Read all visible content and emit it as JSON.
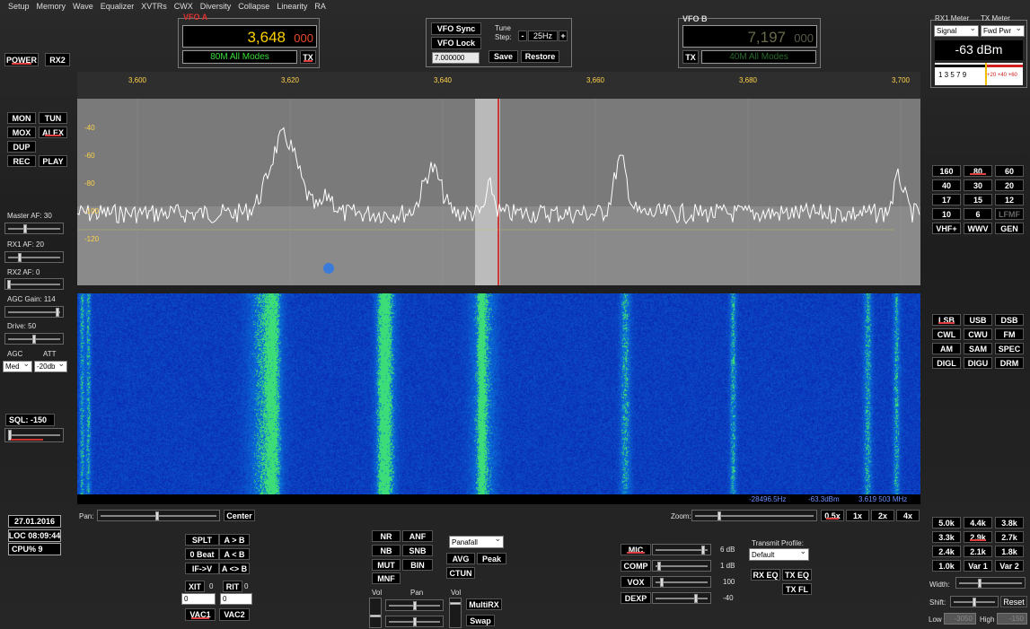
{
  "menu": [
    "Setup",
    "Memory",
    "Wave",
    "Equalizer",
    "XVTRs",
    "CWX",
    "Diversity",
    "Collapse",
    "Linearity",
    "RA"
  ],
  "left": {
    "power": "POWER",
    "rx2": "RX2",
    "mon": "MON",
    "tun": "TUN",
    "mox": "MOX",
    "alex": "ALEX",
    "dup": "DUP",
    "rec": "REC",
    "play": "PLAY",
    "master_af": "Master AF:  30",
    "rx1_af": "RX1 AF:  20",
    "rx2_af": "RX2 AF:  0",
    "agc_gain": "AGC Gain:  114",
    "drive": "Drive:  50",
    "agc": "AGC",
    "att": "ATT",
    "agc_val": "Med",
    "att_val": "-20db",
    "sql": "SQL: -150",
    "date": "27.01.2016",
    "loc": "LOC 08:09:44",
    "cpu": "CPU%  9"
  },
  "vfoa": {
    "label": "VFO A",
    "freq": "3,648",
    "freq_sub": "000",
    "mode": "80M All Modes",
    "tx": "TX"
  },
  "vfob": {
    "label": "VFO B",
    "freq": "7,197",
    "freq_sub": "000",
    "mode": "40M All Modes",
    "tx": "TX"
  },
  "center": {
    "vfo_sync": "VFO Sync",
    "vfo_lock": "VFO Lock",
    "tune": "Tune",
    "step": "Step:",
    "step_val": "25Hz",
    "minus": "-",
    "plus": "+",
    "freq": "7.000000",
    "save": "Save",
    "restore": "Restore"
  },
  "meter": {
    "rx1_label": "RX1 Meter",
    "tx_label": "TX Meter",
    "rx1_val": "Signal",
    "tx_val": "Fwd Pwr",
    "reading": "-63 dBm",
    "scale_white": "1   3   5   7   9",
    "scale_red": "+20 +40 +60"
  },
  "spectrum": {
    "x_ticks": [
      "3,600",
      "3,620",
      "3,640",
      "3,660",
      "3,680",
      "3,700"
    ],
    "y_ticks": [
      "-40",
      "-60",
      "-80",
      "-100",
      "-120"
    ]
  },
  "waterfall": {
    "offset": "-28496.5Hz",
    "dbm": "-63.3dBm",
    "freq": "3.619 503 MHz"
  },
  "bands": [
    [
      "160",
      "80",
      "60"
    ],
    [
      "40",
      "30",
      "20"
    ],
    [
      "17",
      "15",
      "12"
    ],
    [
      "10",
      "6",
      "LFMF"
    ],
    [
      "VHF+",
      "WWV",
      "GEN"
    ]
  ],
  "modes": [
    [
      "LSB",
      "USB",
      "DSB"
    ],
    [
      "CWL",
      "CWU",
      "FM"
    ],
    [
      "AM",
      "SAM",
      "SPEC"
    ],
    [
      "DIGL",
      "DIGU",
      "DRM"
    ]
  ],
  "filters": [
    [
      "5.0k",
      "4.4k",
      "3.8k"
    ],
    [
      "3.3k",
      "2.9k",
      "2.7k"
    ],
    [
      "2.4k",
      "2.1k",
      "1.8k"
    ],
    [
      "1.0k",
      "Var 1",
      "Var 2"
    ]
  ],
  "filter_ctrl": {
    "width": "Width:",
    "shift": "Shift:",
    "reset": "Reset",
    "low": "Low",
    "low_val": "-3050",
    "high": "High",
    "high_val": "-150"
  },
  "pan": {
    "label": "Pan:",
    "center": "Center",
    "zoom": "Zoom:",
    "z05": "0.5x",
    "z1": "1x",
    "z2": "2x",
    "z4": "4x"
  },
  "bottom_left": {
    "splt": "SPLT",
    "atob": "A > B",
    "zero_beat": "0 Beat",
    "btoa": "A < B",
    "ifv": "IF->V",
    "swap": "A <> B",
    "xit": "XIT",
    "xit_val": "0",
    "rit": "RIT",
    "rit_val": "0",
    "xit_in": "0",
    "rit_in": "0",
    "vac1": "VAC1",
    "vac2": "VAC2"
  },
  "dsp": {
    "nr": "NR",
    "anf": "ANF",
    "nb": "NB",
    "snb": "SNB",
    "mut": "MUT",
    "bin": "BIN",
    "mnf": "MNF",
    "display": "Panafall",
    "avg": "AVG",
    "peak": "Peak",
    "ctun": "CTUN",
    "vol": "Vol",
    "pan": "Pan",
    "vol2": "Vol",
    "multirx": "MultiRX",
    "swap": "Swap"
  },
  "tx": {
    "mic": "MIC",
    "mic_val": "6 dB",
    "comp": "COMP",
    "comp_val": "1 dB",
    "vox": "VOX",
    "vox_val": "100",
    "dexp": "DEXP",
    "dexp_val": "-40",
    "profile_label": "Transmit Profile:",
    "profile": "Default",
    "rxeq": "RX EQ",
    "txeq": "TX EQ",
    "txfl": "TX FL"
  }
}
